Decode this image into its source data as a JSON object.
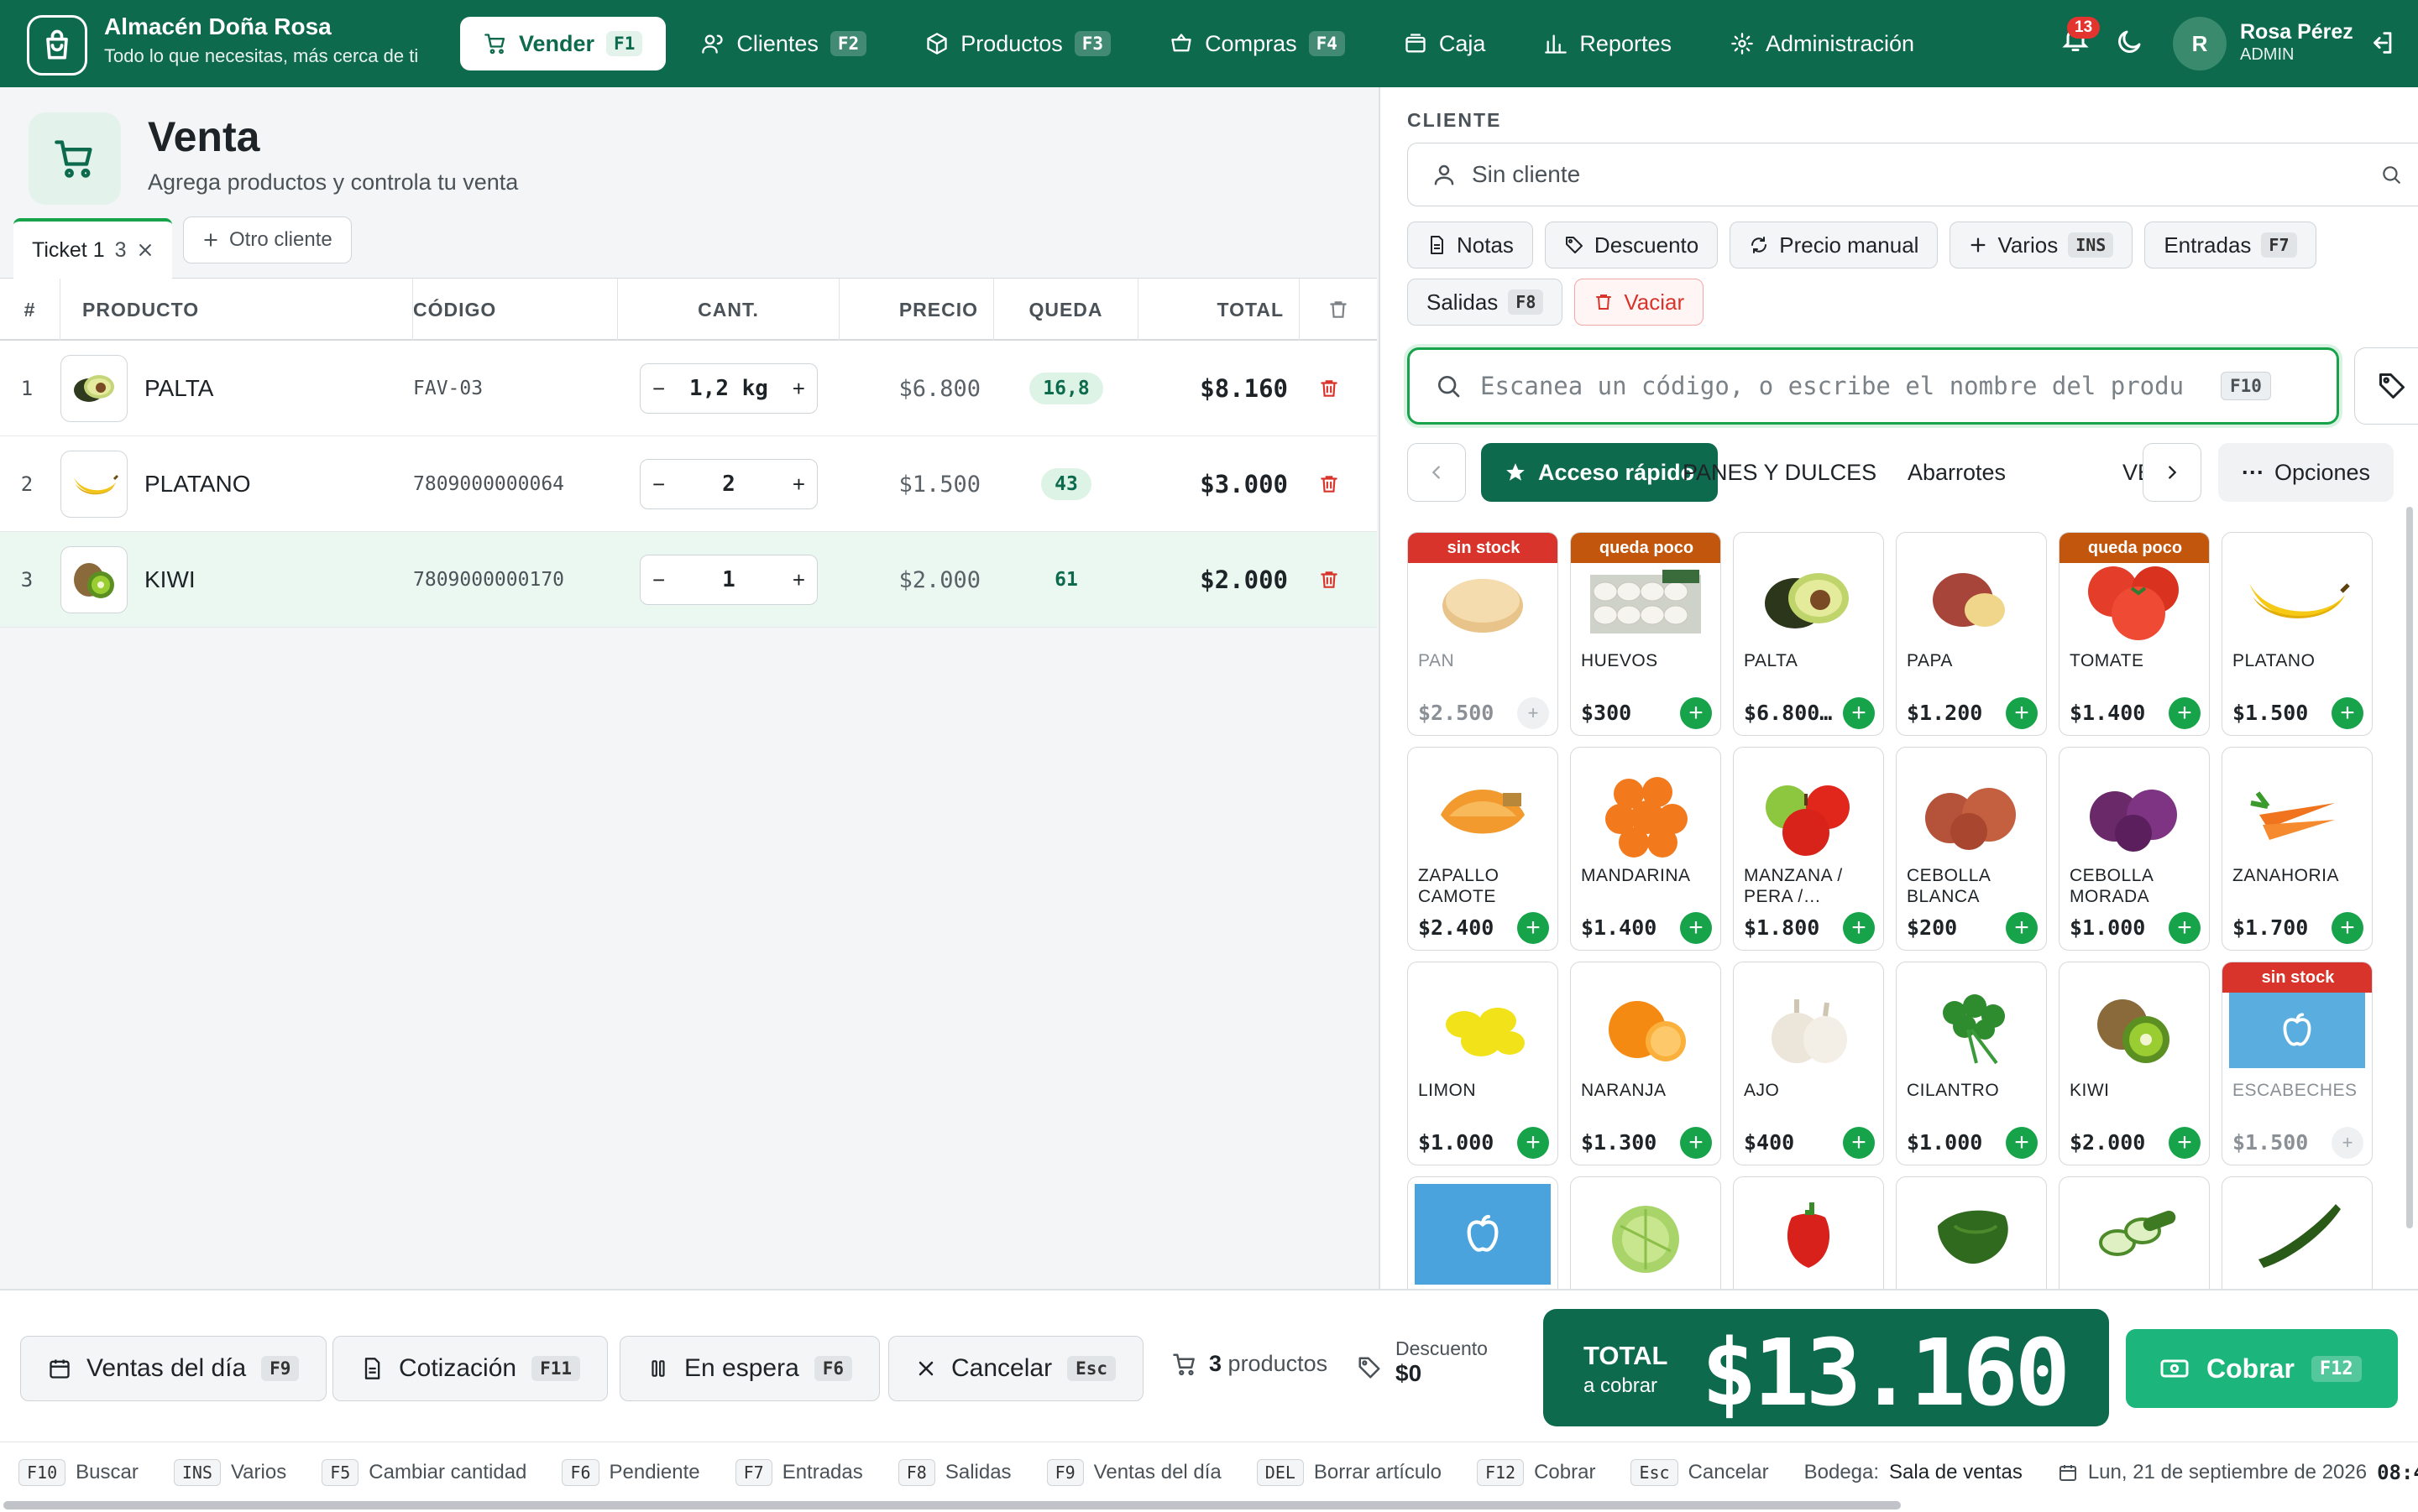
{
  "app": {
    "name": "Almacén Doña Rosa",
    "tagline": "Todo lo que necesitas, más cerca de ti"
  },
  "nav": [
    {
      "label": "Vender",
      "key": "F1",
      "icon": "cart-icon",
      "active": true
    },
    {
      "label": "Clientes",
      "key": "F2",
      "icon": "users-icon"
    },
    {
      "label": "Productos",
      "key": "F3",
      "icon": "box-icon"
    },
    {
      "label": "Compras",
      "key": "F4",
      "icon": "basket-icon"
    },
    {
      "label": "Caja",
      "key": "",
      "icon": "wallet-icon"
    },
    {
      "label": "Reportes",
      "key": "",
      "icon": "bar-chart-icon"
    },
    {
      "label": "Administración",
      "key": "",
      "icon": "gear-icon"
    }
  ],
  "user": {
    "notifications": "13",
    "initial": "R",
    "name": "Rosa Pérez",
    "role": "ADMIN"
  },
  "page": {
    "title": "Venta",
    "subtitle": "Agrega productos y controla tu venta"
  },
  "tickets": {
    "active_label": "Ticket 1",
    "active_count": "3",
    "add_label": "Otro cliente"
  },
  "table": {
    "headers": {
      "num": "#",
      "product": "PRODUCTO",
      "code": "CÓDIGO",
      "qty": "CANT.",
      "price": "PRECIO",
      "left": "QUEDA",
      "total": "TOTAL"
    },
    "rows": [
      {
        "n": "1",
        "name": "PALTA",
        "code": "FAV-03",
        "qty": "1,2 kg",
        "price": "$6.800",
        "left": "16,8",
        "total": "$8.160"
      },
      {
        "n": "2",
        "name": "PLATANO",
        "code": "7809000000064",
        "qty": "2",
        "price": "$1.500",
        "left": "43",
        "total": "$3.000"
      },
      {
        "n": "3",
        "name": "KIWI",
        "code": "7809000000170",
        "qty": "1",
        "price": "$2.000",
        "left": "61",
        "total": "$2.000"
      }
    ]
  },
  "customer": {
    "label": "CLIENTE",
    "placeholder": "Sin cliente"
  },
  "actions": [
    {
      "label": "Notas",
      "key": ""
    },
    {
      "label": "Descuento",
      "key": ""
    },
    {
      "label": "Precio manual",
      "key": ""
    },
    {
      "label": "Varios",
      "key": "INS"
    },
    {
      "label": "Entradas",
      "key": "F7"
    },
    {
      "label": "Salidas",
      "key": "F8"
    },
    {
      "label": "Vaciar",
      "key": ""
    }
  ],
  "search": {
    "placeholder": "Escanea un código, o escribe el nombre del produ",
    "key": "F10"
  },
  "categories": {
    "quick": "Acceso rápido",
    "items": [
      "PANES Y DULCES",
      "Abarrotes",
      "VE"
    ],
    "options": "Opciones"
  },
  "products": [
    {
      "name": "PAN",
      "price": "$2.500",
      "badge": "sin stock",
      "badge_color": "#d8342b"
    },
    {
      "name": "HUEVOS",
      "price": "$300",
      "badge": "queda poco",
      "badge_color": "#c2560c"
    },
    {
      "name": "PALTA",
      "price": "$6.800…",
      "badge": ""
    },
    {
      "name": "PAPA",
      "price": "$1.200",
      "badge": ""
    },
    {
      "name": "TOMATE",
      "price": "$1.400",
      "badge": "queda poco",
      "badge_color": "#c2560c"
    },
    {
      "name": "PLATANO",
      "price": "$1.500",
      "badge": ""
    },
    {
      "name": "ZAPALLO CAMOTE",
      "price": "$2.400",
      "badge": ""
    },
    {
      "name": "MANDARINA",
      "price": "$1.400",
      "badge": ""
    },
    {
      "name": "MANZANA / PERA /…",
      "price": "$1.800",
      "badge": ""
    },
    {
      "name": "CEBOLLA BLANCA",
      "price": "$200",
      "badge": ""
    },
    {
      "name": "CEBOLLA MORADA",
      "price": "$1.000",
      "badge": ""
    },
    {
      "name": "ZANAHORIA",
      "price": "$1.700",
      "badge": ""
    },
    {
      "name": "LIMON",
      "price": "$1.000",
      "badge": ""
    },
    {
      "name": "NARANJA",
      "price": "$1.300",
      "badge": ""
    },
    {
      "name": "AJO",
      "price": "$400",
      "badge": ""
    },
    {
      "name": "CILANTRO",
      "price": "$1.000",
      "badge": ""
    },
    {
      "name": "KIWI",
      "price": "$2.000",
      "badge": ""
    },
    {
      "name": "ESCABECHES",
      "price": "$1.500",
      "badge": "sin stock",
      "badge_color": "#d8342b"
    }
  ],
  "bottom": {
    "buttons": [
      {
        "label": "Ventas del día",
        "key": "F9"
      },
      {
        "label": "Cotización",
        "key": "F11"
      },
      {
        "label": "En espera",
        "key": "F6"
      },
      {
        "label": "Cancelar",
        "key": "Esc"
      }
    ],
    "count_num": "3",
    "count_label": "productos",
    "discount_label": "Descuento",
    "discount_value": "$0",
    "total_label": "TOTAL",
    "total_sub": "a cobrar",
    "total_value": "$13.160",
    "pay_label": "Cobrar",
    "pay_key": "F12"
  },
  "status": {
    "shortcuts": [
      {
        "key": "F10",
        "label": "Buscar"
      },
      {
        "key": "INS",
        "label": "Varios"
      },
      {
        "key": "F5",
        "label": "Cambiar cantidad"
      },
      {
        "key": "F6",
        "label": "Pendiente"
      },
      {
        "key": "F7",
        "label": "Entradas"
      },
      {
        "key": "F8",
        "label": "Salidas"
      },
      {
        "key": "F9",
        "label": "Ventas del día"
      },
      {
        "key": "DEL",
        "label": "Borrar artículo"
      },
      {
        "key": "F12",
        "label": "Cobrar"
      },
      {
        "key": "Esc",
        "label": "Cancelar"
      }
    ],
    "store_label": "Bodega:",
    "store_value": "Sala de ventas",
    "date": "Lun, 21 de septiembre de 2026",
    "time": "08:4"
  },
  "colors": {
    "primary": "#0e6a4d",
    "accent": "#1cb57b",
    "danger": "#d8342b",
    "warning": "#c2560c"
  }
}
